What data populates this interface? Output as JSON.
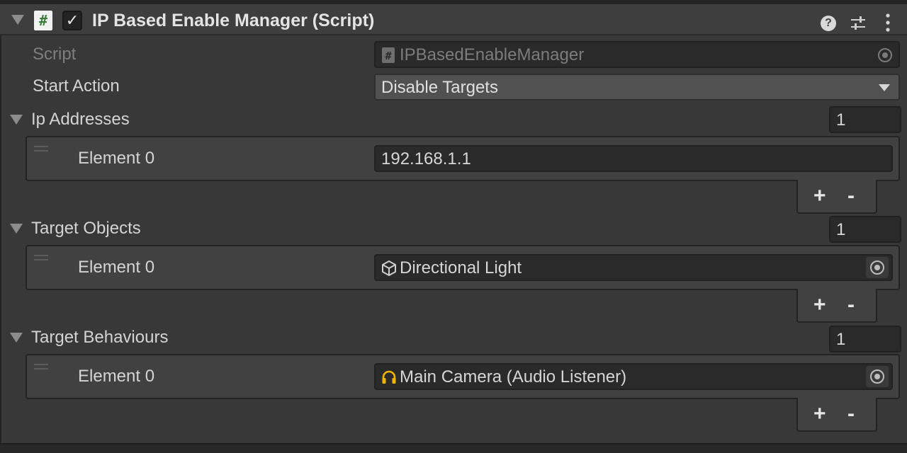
{
  "component": {
    "title": "IP Based Enable Manager (Script)",
    "enabled": true,
    "script_glyph": "#"
  },
  "fields": {
    "script": {
      "label": "Script",
      "value": "IPBasedEnableManager"
    },
    "start_action": {
      "label": "Start Action",
      "value": "Disable Targets"
    }
  },
  "lists": {
    "ip_addresses": {
      "label": "Ip Addresses",
      "size": "1",
      "elements": [
        {
          "label": "Element 0",
          "value": "192.168.1.1"
        }
      ]
    },
    "target_objects": {
      "label": "Target Objects",
      "size": "1",
      "elements": [
        {
          "label": "Element 0",
          "value": "Directional Light",
          "icon": "cube-icon"
        }
      ]
    },
    "target_behaviours": {
      "label": "Target Behaviours",
      "size": "1",
      "elements": [
        {
          "label": "Element 0",
          "value": "Main Camera (Audio Listener)",
          "icon": "headphones-icon"
        }
      ]
    }
  },
  "list_buttons": {
    "add": "+",
    "remove": "-"
  },
  "icons": {
    "help": "help-icon",
    "presets": "presets-icon",
    "menu": "kebab-menu-icon",
    "object_picker": "object-picker-icon"
  },
  "colors": {
    "panel": "#383838",
    "header": "#3e3e3e",
    "field": "#2a2a2a",
    "dropdown": "#515151",
    "accent_headphones": "#f0b400",
    "script_icon_green": "#3a7d3a"
  }
}
